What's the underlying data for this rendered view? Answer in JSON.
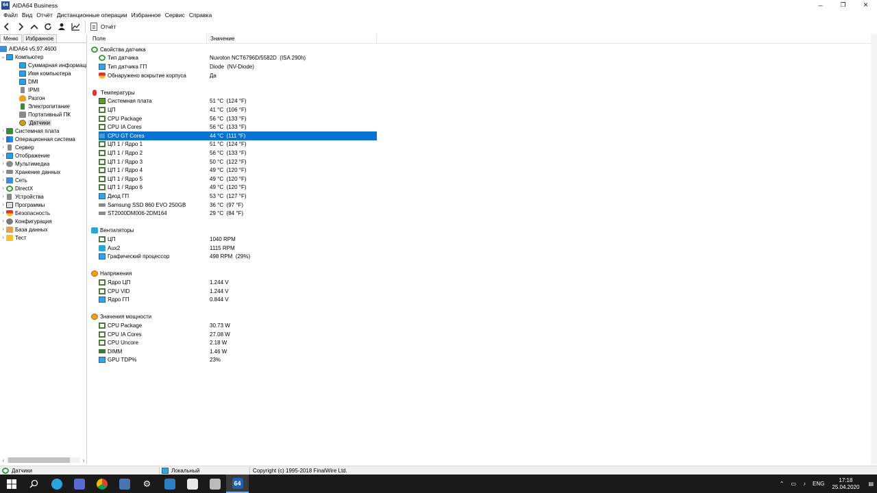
{
  "window": {
    "app_icon": "64",
    "title": "AIDA64 Business",
    "min": "─",
    "max": "❐",
    "close": "✕"
  },
  "menu": [
    "Файл",
    "Вид",
    "Отчёт",
    "Дистанционные операции",
    "Избранное",
    "Сервис",
    "Справка"
  ],
  "toolbar": {
    "report_label": "Отчёт"
  },
  "left_panel": {
    "tabs": [
      "Меню",
      "Избранное"
    ],
    "root": "AIDA64 v5.97.4600",
    "computer": "Компьютер",
    "computer_children": [
      "Суммарная информация",
      "Имя компьютера",
      "DMI",
      "IPMI",
      "Разгон",
      "Электропитание",
      "Портативный ПК",
      "Датчики"
    ],
    "top_items": [
      "Системная плата",
      "Операционная система",
      "Сервер",
      "Отображение",
      "Мультимедиа",
      "Хранение данных",
      "Сеть",
      "DirectX",
      "Устройства",
      "Программы",
      "Безопасность",
      "Конфигурация",
      "База данных",
      "Тест"
    ]
  },
  "columns": {
    "field": "Поле",
    "value": "Значение"
  },
  "groups": {
    "sensor_props": {
      "title": "Свойства датчика",
      "rows": [
        {
          "field": "Тип датчика",
          "value": "Nuvoton NCT6796D/5582D  (ISA 290h)"
        },
        {
          "field": "Тип датчика ГП",
          "value": "Diode  (NV-Diode)"
        },
        {
          "field": "Обнаружено вскрытие корпуса",
          "value": "Да"
        }
      ]
    },
    "temps": {
      "title": "Температуры",
      "rows": [
        {
          "field": "Системная плата",
          "value": "51 °C  (124 °F)"
        },
        {
          "field": "ЦП",
          "value": "41 °C  (106 °F)"
        },
        {
          "field": "CPU Package",
          "value": "56 °C  (133 °F)"
        },
        {
          "field": "CPU IA Cores",
          "value": "56 °C  (133 °F)"
        },
        {
          "field": "CPU GT Cores",
          "value": "44 °C  (111 °F)"
        },
        {
          "field": "ЦП 1 / Ядро 1",
          "value": "51 °C  (124 °F)"
        },
        {
          "field": "ЦП 1 / Ядро 2",
          "value": "56 °C  (133 °F)"
        },
        {
          "field": "ЦП 1 / Ядро 3",
          "value": "50 °C  (122 °F)"
        },
        {
          "field": "ЦП 1 / Ядро 4",
          "value": "49 °C  (120 °F)"
        },
        {
          "field": "ЦП 1 / Ядро 5",
          "value": "49 °C  (120 °F)"
        },
        {
          "field": "ЦП 1 / Ядро 6",
          "value": "49 °C  (120 °F)"
        },
        {
          "field": "Диод ГП",
          "value": "53 °C  (127 °F)"
        },
        {
          "field": "Samsung SSD 860 EVO 250GB",
          "value": "36 °C  (97 °F)"
        },
        {
          "field": "ST2000DM006-2DM164",
          "value": "29 °C  (84 °F)"
        }
      ]
    },
    "fans": {
      "title": "Вентиляторы",
      "rows": [
        {
          "field": "ЦП",
          "value": "1040 RPM"
        },
        {
          "field": "Aux2",
          "value": "1115 RPM"
        },
        {
          "field": "Графический процессор",
          "value": "498 RPM  (29%)"
        }
      ]
    },
    "volts": {
      "title": "Напряжения",
      "rows": [
        {
          "field": "Ядро ЦП",
          "value": "1.244 V"
        },
        {
          "field": "CPU VID",
          "value": "1.244 V"
        },
        {
          "field": "Ядро ГП",
          "value": "0.844 V"
        }
      ]
    },
    "power": {
      "title": "Значения мощности",
      "rows": [
        {
          "field": "CPU Package",
          "value": "30.73 W"
        },
        {
          "field": "CPU IA Cores",
          "value": "27.08 W"
        },
        {
          "field": "CPU Uncore",
          "value": "2.18 W"
        },
        {
          "field": "DIMM",
          "value": "1.46 W"
        },
        {
          "field": "GPU TDP%",
          "value": "23%"
        }
      ]
    }
  },
  "status": {
    "left": "Датчики",
    "middle": "Локальный",
    "right": "Copyright (c) 1995-2018 FinalWire Ltd."
  },
  "taskbar": {
    "lang": "ENG",
    "time": "17:18",
    "date": "25.04.2020",
    "aida_label": "64"
  }
}
